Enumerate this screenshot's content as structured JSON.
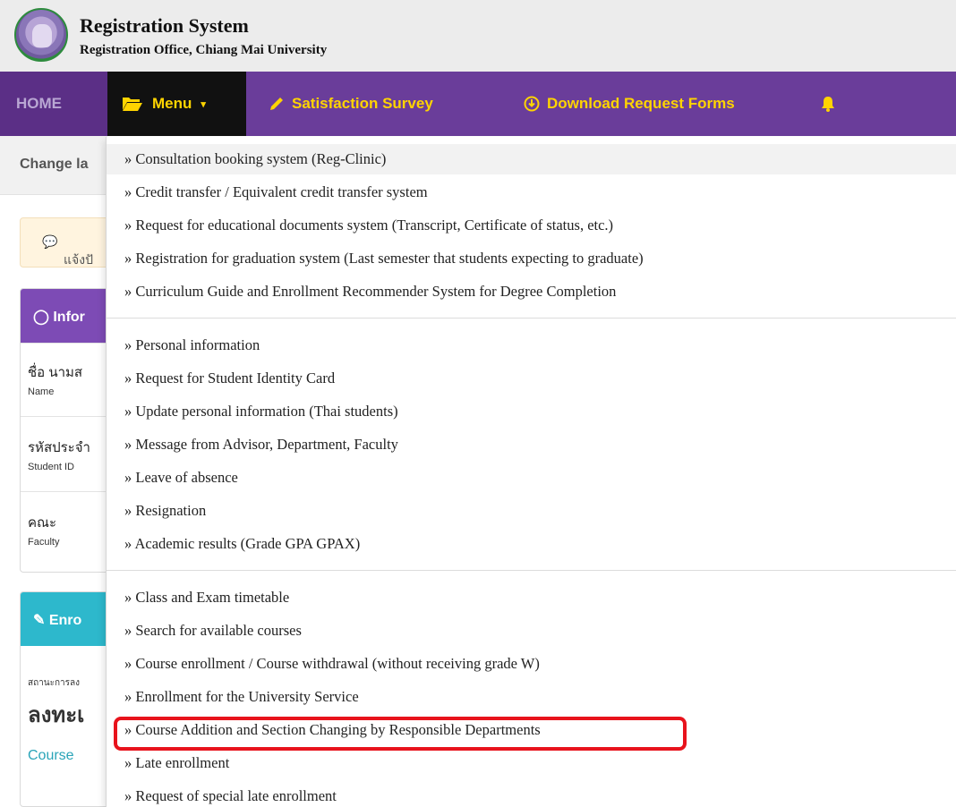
{
  "header": {
    "title": "Registration System",
    "subtitle": "Registration Office, Chiang Mai University"
  },
  "navbar": {
    "home": "HOME",
    "menu": "Menu",
    "survey": "Satisfaction Survey",
    "forms": "Download Request Forms"
  },
  "background": {
    "change_language": "Change la",
    "notice": "แจ้งปั",
    "info_card_title": "Infor",
    "rows": [
      {
        "th": "ชื่อ นามส",
        "en": "Name"
      },
      {
        "th": "รหัสประจำ",
        "en": "Student ID"
      },
      {
        "th": "คณะ",
        "en": "Faculty"
      }
    ],
    "enroll_card_title": "Enro",
    "enroll_status": "สถานะการลง",
    "enroll_big": "ลงทะเ",
    "enroll_link": "Course"
  },
  "dropdown": {
    "prefix": "»",
    "items": [
      "Consultation booking system (Reg-Clinic)",
      "Credit transfer / Equivalent credit transfer system",
      "Request for educational documents system (Transcript, Certificate of status, etc.)",
      "Registration for graduation system (Last semester that students expecting to graduate)",
      "Curriculum Guide and Enrollment Recommender System for Degree Completion",
      "Personal information",
      "Request for Student Identity Card",
      "Update personal information (Thai students)",
      "Message from Advisor, Department, Faculty",
      "Leave of absence",
      "Resignation",
      "Academic results (Grade GPA GPAX)",
      "Class and Exam timetable",
      "Search for available courses",
      "Course enrollment / Course withdrawal (without receiving grade W)",
      "Enrollment for the University Service",
      "Course Addition and Section Changing by Responsible Departments",
      "Late enrollment",
      "Request of special late enrollment"
    ],
    "highlighted_item": "Course Addition and Section Changing by Responsible Departments",
    "highlight_color": "#e8131c"
  },
  "colors": {
    "navbar": "#6a3d9a",
    "nav_text": "#ffd400",
    "menu_bg": "#111111"
  }
}
